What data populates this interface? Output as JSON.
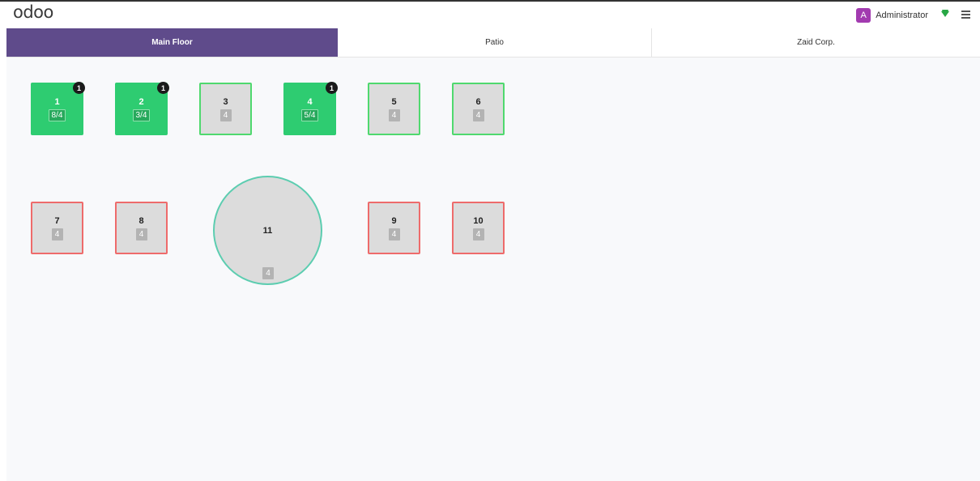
{
  "header": {
    "logo": "odoo",
    "user": {
      "initial": "A",
      "name": "Administrator"
    }
  },
  "floors": {
    "tabs": [
      "Main Floor",
      "Patio",
      "Zaid Corp."
    ],
    "active": "Main Floor"
  },
  "tables": [
    {
      "name": "1",
      "seats": "8/4",
      "orders": "1",
      "status": "occupied"
    },
    {
      "name": "2",
      "seats": "3/4",
      "orders": "1",
      "status": "occupied"
    },
    {
      "name": "3",
      "seats": "4",
      "status": "free"
    },
    {
      "name": "4",
      "seats": "5/4",
      "orders": "1",
      "status": "occupied"
    },
    {
      "name": "5",
      "seats": "4",
      "status": "free"
    },
    {
      "name": "6",
      "seats": "4",
      "status": "free"
    },
    {
      "name": "7",
      "seats": "4",
      "status": "red"
    },
    {
      "name": "8",
      "seats": "4",
      "status": "red"
    },
    {
      "name": "11",
      "seats": "4",
      "status": "round"
    },
    {
      "name": "9",
      "seats": "4",
      "status": "red"
    },
    {
      "name": "10",
      "seats": "4",
      "status": "red"
    }
  ],
  "colors": {
    "brand_purple": "#5f4b8b",
    "occupied_green": "#2ecc71",
    "free_border_green": "#4fd96e",
    "red_border": "#ee6b6b",
    "round_border": "#5ccdb0",
    "avatar": "#a23bb0"
  },
  "icons": [
    "wifi-icon",
    "hamburger-menu-icon"
  ]
}
